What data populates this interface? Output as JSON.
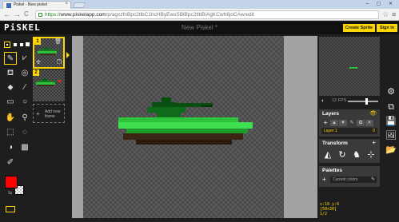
{
  "browser": {
    "tab_title": "Piskel - New piskel",
    "tab_close": "×",
    "window_controls": "‒ ▢ ✕",
    "back": "←",
    "forward": "→",
    "reload": "C",
    "url_scheme": "https://",
    "url_host": "www.piskelapp.com",
    "url_path": "/p/agxzfnBpc2tlbC1hcHByEwsSBlBpc2tlbBiAgKCwh6joCAw/edit",
    "star": "☆",
    "menu": "≡"
  },
  "app": {
    "logo": "PiSKEL",
    "document_title": "New Piskel *",
    "create_sprite_label": "Create Sprite",
    "sign_in_label": "Sign in"
  },
  "frames": {
    "items": [
      {
        "number": "1",
        "selected": true
      },
      {
        "number": "2",
        "selected": false
      }
    ],
    "add_frame_plus": "+",
    "add_frame_label_1": "Add new",
    "add_frame_label_2": "frame"
  },
  "preview": {
    "fps_label": "12 FPS",
    "fps": 12
  },
  "layers": {
    "title": "Layers",
    "add": "+",
    "layer_name": "Layer 1",
    "layer_count": "0"
  },
  "transform": {
    "title": "Transform",
    "add": "+"
  },
  "palettes": {
    "title": "Palettes",
    "add": "+",
    "selected": "Current colors"
  },
  "status": {
    "cursor": "x:18 y:6",
    "size": "[50x30]",
    "frame": "1/2"
  },
  "colors": {
    "primary": "#ff0000",
    "secondary": "transparent",
    "accent": "#ffd700"
  },
  "icons": [
    "pen-icon",
    "mirror-pen-icon",
    "bucket-icon",
    "stroke-icon",
    "eraser-icon",
    "line-icon",
    "rectangle-icon",
    "circle-icon",
    "move-icon",
    "eyedropper-icon",
    "rect-select-icon",
    "lasso-select-icon",
    "shape-select-icon",
    "dither-icon",
    "settings-icon",
    "resize-icon",
    "save-icon",
    "export-icon",
    "import-icon"
  ]
}
